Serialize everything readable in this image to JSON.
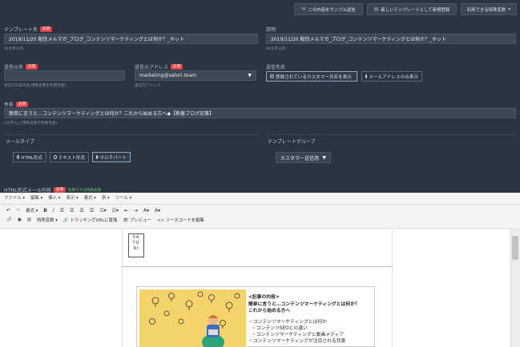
{
  "toolbar_top": {
    "sample_send": "この内容をサンプル送信",
    "save_new": "新しいテンプレートとして新規登録",
    "variables": "利用できる特殊変数"
  },
  "required_badge": "必須",
  "template_name": {
    "label": "テンプレート名",
    "value": "2019/11/20 配信メルマガ_ブログ_コンテンツマーケティングとは何か？_ホット",
    "hint": "64文字以内"
  },
  "description": {
    "label": "説明",
    "value": "2019/11/20 配信メルマガ_ブログ_コンテンツマーケティングとは何か？_ホット",
    "hint": "64文字以内"
  },
  "sender_name": {
    "label": "送信元名",
    "hint": "送信元の表示名(特殊変数を利用可能)"
  },
  "sender_address": {
    "label": "送信元アドレス",
    "value": "marketing@satori.team",
    "hint": "送信元アドレス"
  },
  "recipient": {
    "label": "送信先名",
    "option_customer": "登録されているカスタマー氏名を表示",
    "option_email": "メールアドレスのみ表示"
  },
  "subject": {
    "label": "件名",
    "value": "簡単に言うと…コンテンツマーケティングとは何か？これから始める方へ◆【新着ブログ記事】",
    "hint": "1文字以上(特殊変数を利用可能)"
  },
  "mail_type": {
    "label": "メールタイプ",
    "options": [
      "HTML形式",
      "テキスト形式",
      "マルチパート"
    ],
    "selected": "マルチパート"
  },
  "template_group": {
    "label": "テンプレートグループ",
    "value": "カスタマー送信用"
  },
  "html_body": {
    "label": "HTML形式メール内容",
    "sublabel": "利用できる特殊変数"
  },
  "editor_menu": [
    "ファイル",
    "編集",
    "挿入",
    "表示",
    "書式",
    "表",
    "ツール"
  ],
  "editor_toolbar": {
    "format": "書式",
    "special_vars": "特殊変数",
    "tracking_url": "トラッキングURLに置換",
    "preview": "プレビュー",
    "source_edit": "ソースコードを編集"
  },
  "article": {
    "logo_lines": [
      "SA",
      "TO",
      "RI"
    ],
    "heading": "<記事の内容>",
    "lead1": "簡単に言うと…コンテンツマーケティングとは何か？",
    "lead2": "これから始める方へ",
    "bullets": [
      "・コンテンツマーケティングとは何か",
      "・コンテンツSEOとの違い",
      "・コンテンツマーケティングと動画メディア",
      "・コンテンツマーケティングが注目される背景"
    ]
  },
  "colors": {
    "background": "#2b3541",
    "required": "#e0474c",
    "editor_bg": "#f4f4f4"
  }
}
